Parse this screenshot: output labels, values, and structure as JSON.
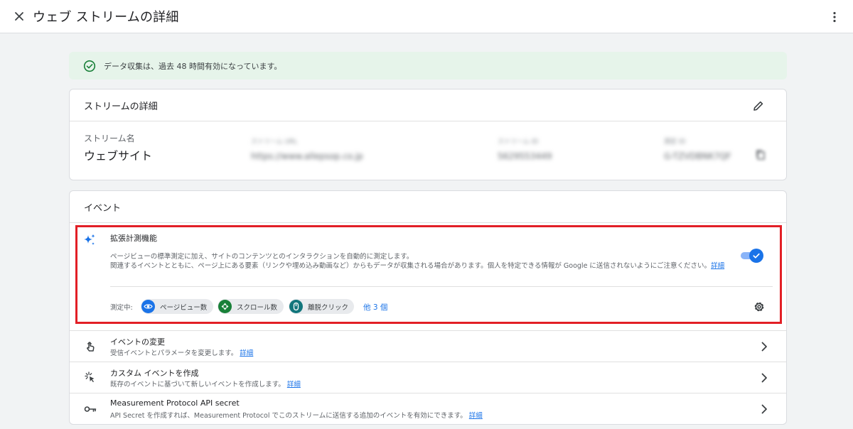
{
  "header": {
    "title": "ウェブ ストリームの詳細",
    "close_icon": "close-icon",
    "more_icon": "more-vert-icon"
  },
  "banner": {
    "text": "データ収集は、過去 48 時間有効になっています。",
    "icon": "check-circle-icon",
    "color": "#e6f4ea"
  },
  "stream_card": {
    "title": "ストリームの詳細",
    "name_label": "ストリーム名",
    "name_value": "ウェブサイト",
    "blurred": {
      "url_label": "ストリーム URL",
      "url_value": "https://www.allepsop.co.jp",
      "id_label": "ストリーム ID",
      "id_value": "5629553449",
      "mid_label": "測定 ID",
      "mid_value": "G-TZVDBNK7QF"
    }
  },
  "events_card": {
    "title": "イベント",
    "enhanced": {
      "title": "拡張計測機能",
      "desc_line1": "ページビューの標準測定に加え、サイトのコンテンツとのインタラクションを自動的に測定します。",
      "desc_line2": "関連するイベントとともに、ページ上にある要素（リンクや埋め込み動画など）からもデータが収集される場合があります。個人を特定できる情報が Google に送信されないようにご注意ください。",
      "desc_link": "詳細",
      "toggle_on": true,
      "measuring_label": "測定中:",
      "chips": [
        {
          "label": "ページビュー数",
          "icon": "eye-icon",
          "color": "#1a73e8"
        },
        {
          "label": "スクロール数",
          "icon": "scroll-icon",
          "color": "#188038"
        },
        {
          "label": "離脱クリック",
          "icon": "mouse-icon",
          "color": "#12767c"
        }
      ],
      "more_count": "他 3 個"
    },
    "rows": [
      {
        "title": "イベントの変更",
        "sub": "受信イベントとパラメータを変更します。",
        "link": "詳細",
        "icon": "touch-icon"
      },
      {
        "title": "カスタム イベントを作成",
        "sub": "既存のイベントに基づいて新しいイベントを作成します。",
        "link": "詳細",
        "icon": "click-spark-icon"
      },
      {
        "title": "Measurement Protocol API secret",
        "sub": "API Secret を作成すれば、Measurement Protocol でこのストリームに送信する追加のイベントを有効にできます。",
        "link": "詳細",
        "icon": "key-icon"
      }
    ]
  },
  "colors": {
    "accent": "#1a73e8",
    "highlight_border": "#e21f26"
  }
}
